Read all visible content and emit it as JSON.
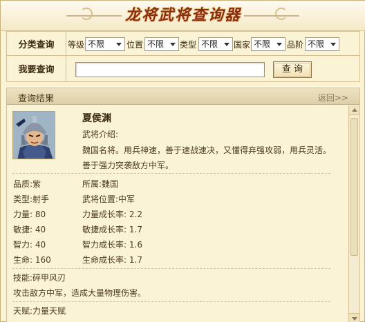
{
  "title": "龙将武将查询器",
  "filter_row": {
    "label": "分类查询",
    "filters": [
      {
        "label": "等级",
        "value": "不限"
      },
      {
        "label": "位置",
        "value": "不限"
      },
      {
        "label": "类型",
        "value": "不限"
      },
      {
        "label": "国家",
        "value": "不限"
      },
      {
        "label": "品阶",
        "value": "不限"
      }
    ]
  },
  "search_row": {
    "label": "我要查询",
    "input_value": "",
    "button_label": "查 询"
  },
  "results": {
    "header": "查询结果",
    "back_link": "返回>>",
    "general": {
      "name": "夏侯渊",
      "intro_label": "武将介绍:",
      "intro_lines": [
        "魏国名将。用兵神速，善于速战速决，又懂得弃强攻弱，用兵灵活。",
        "善于强力突袭敌方中军。"
      ],
      "left_stats": [
        {
          "key": "品质:",
          "value": "紫"
        },
        {
          "key": "类型:",
          "value": "射手"
        },
        {
          "key": "力量:",
          "value": "80"
        },
        {
          "key": "敏捷:",
          "value": "40"
        },
        {
          "key": "智力:",
          "value": "40"
        },
        {
          "key": "生命:",
          "value": "160"
        }
      ],
      "right_stats": [
        {
          "key": "所属:",
          "value": "魏国"
        },
        {
          "key": "武将位置:",
          "value": "中军"
        },
        {
          "key": "力量成长率:",
          "value": "2.2"
        },
        {
          "key": "敏捷成长率:",
          "value": "1.7"
        },
        {
          "key": "智力成长率:",
          "value": "1.6"
        },
        {
          "key": "生命成长率:",
          "value": "1.7"
        }
      ],
      "skill_label": "技能:",
      "skill_name": "碎甲风刃",
      "skill_desc": "攻击敌方中军，造成大量物理伤害。",
      "talent_label": "天赋:",
      "talent_name": "力量天赋"
    }
  },
  "colors": {
    "background": "#fbf3d6",
    "title": "#8a2c0e",
    "border": "#d6c08f"
  }
}
